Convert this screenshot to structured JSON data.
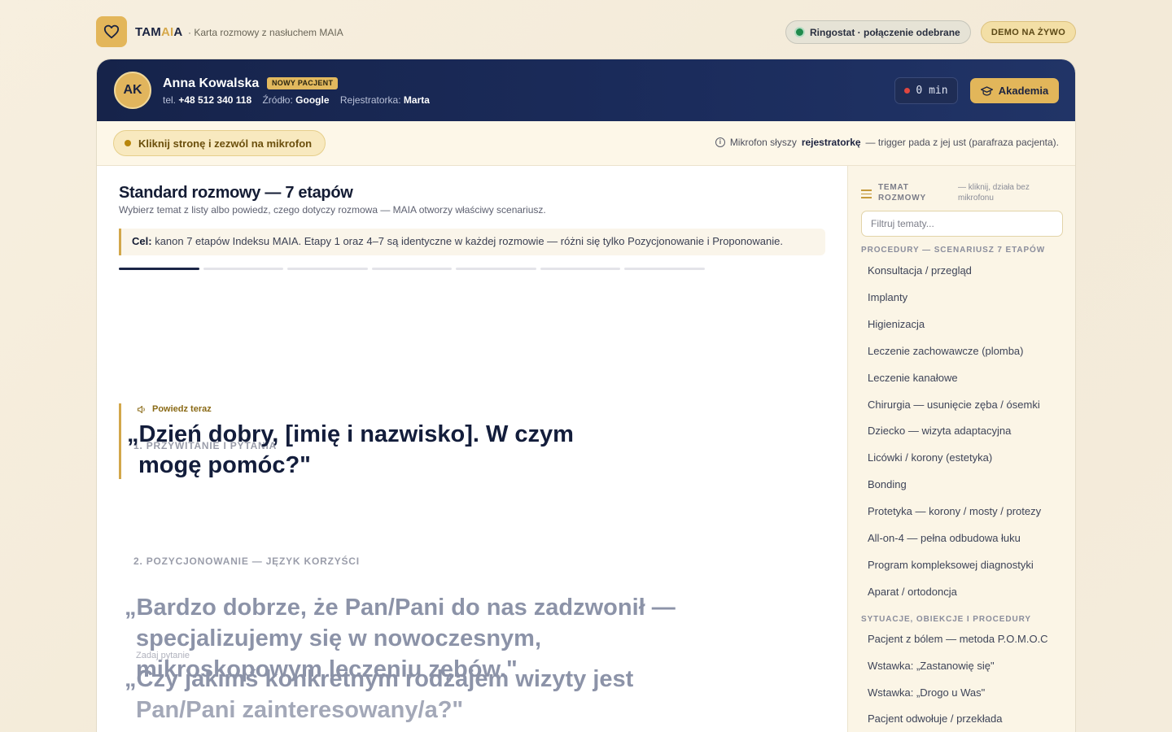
{
  "brand": {
    "name_prefix": "TAM",
    "name_ai": "AI",
    "name_suffix": "A",
    "subtitle": "· Karta rozmowy z nasłuchem MAIA"
  },
  "top": {
    "ringostat": "Ringostat · połączenie odebrane",
    "demo": "DEMO NA ŻYWO"
  },
  "patient": {
    "initials": "AK",
    "name": "Anna Kowalska",
    "badge": "NOWY PACJENT",
    "phone_label": "tel.",
    "phone": "+48 512 340 118",
    "source_label": "Źródło:",
    "source": "Google",
    "registrar_label": "Rejestratorka:",
    "registrar": "Marta"
  },
  "header": {
    "timer": "0 min",
    "akademia": "Akademia"
  },
  "mic": {
    "prompt": "Kliknij stronę i zezwól na mikrofon",
    "info_pre": "Mikrofon słyszy",
    "info_bold": "rejestratorkę",
    "info_post": "— trigger pada z jej ust (parafraza pacjenta)."
  },
  "standard": {
    "title": "Standard rozmowy — 7 etapów",
    "subtitle": "Wybierz temat z listy albo powiedz, czego dotyczy rozmowa — MAIA otworzy właściwy scenariusz.",
    "goal_label": "Cel:",
    "goal_text": "kanon 7 etapów Indeksu MAIA. Etapy 1 oraz 4–7 są identyczne w każdej rozmowie — różni się tylko Pozycjonowanie i Proponowanie.",
    "steps_total": 7,
    "steps_active": 1
  },
  "script": {
    "step1_label": "1. PRZYWITANIE I PYTANIA",
    "say_now": "Powiedz teraz",
    "step1_quote": "„Dzień dobry, [imię i nazwisko]. W czym mogę pomóc?\"",
    "step2_label": "2. POZYCJONOWANIE — JĘZYK KORZYŚCI",
    "step2_quote": "„Bardzo dobrze, że Pan/Pani do nas zadzwonił — specjalizujemy się w nowoczesnym, mikroskopowym leczeniu zębów.\"",
    "ask_label": "Zadaj pytanie",
    "ask_quote_line1": "„Czy jakimś konkretnym rodzajem wizyty jest",
    "ask_quote_line2": "Pan/Pani zainteresowany/a?\""
  },
  "sidebar": {
    "title": "TEMAT ROZMOWY",
    "note": "— kliknij, działa bez mikrofonu",
    "filter_placeholder": "Filtruj tematy...",
    "section1": "PROCEDURY — SCENARIUSZ 7 ETAPÓW",
    "procedures": [
      "Konsultacja / przegląd",
      "Implanty",
      "Higienizacja",
      "Leczenie zachowawcze (plomba)",
      "Leczenie kanałowe",
      "Chirurgia — usunięcie zęba / ósemki",
      "Dziecko — wizyta adaptacyjna",
      "Licówki / korony (estetyka)",
      "Bonding",
      "Protetyka — korony / mosty / protezy",
      "All-on-4 — pełna odbudowa łuku",
      "Program kompleksowej diagnostyki",
      "Aparat / ortodoncja"
    ],
    "section2": "SYTUACJE, OBIEKCJE I PROCEDURY",
    "situations": [
      "Pacjent z bólem — metoda P.O.M.O.C",
      "Wstawka: „Zastanowię się\"",
      "Wstawka: „Drogo u Was\"",
      "Pacjent odwołuje / przekłada"
    ]
  }
}
